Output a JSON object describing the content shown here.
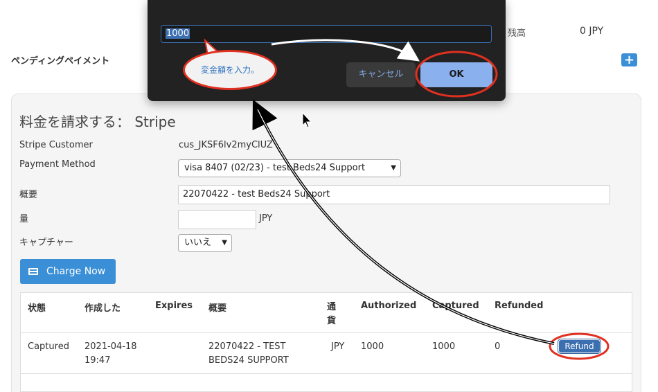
{
  "header": {
    "balance_label": "残高",
    "balance_value": "0 JPY",
    "pending_title": "ペンディングペイメント",
    "add_label": "+"
  },
  "dialog": {
    "input_value": "1000",
    "hint": "変金額を入力。",
    "cancel_label": "キャンセル",
    "ok_label": "OK"
  },
  "charge": {
    "title": "料金を請求する： Stripe",
    "customer_label": "Stripe Customer",
    "customer_value": "cus_JKSF6lv2myClUZ",
    "method_label": "Payment Method",
    "method_value": "visa 8407 (02/23) - test Beds24 Support",
    "summary_label": "概要",
    "summary_value": "22070422 - test Beds24 Support",
    "amount_label": "量",
    "amount_value": "",
    "amount_unit": "JPY",
    "capture_label": "キャプチャー",
    "capture_value": "いいえ",
    "charge_button": "Charge Now"
  },
  "table": {
    "headers": {
      "status": "状態",
      "created": "作成した",
      "expires": "Expires",
      "summary": "概要",
      "currency": "通貨",
      "authorized": "Authorized",
      "captured": "Captured",
      "refunded": "Refunded"
    },
    "rows": [
      {
        "status": "Captured",
        "created_date": "2021-04-18",
        "created_time": "19:47",
        "expires": "",
        "summary_1": "22070422 - TEST",
        "summary_2": "BEDS24 SUPPORT",
        "currency": "JPY",
        "authorized": "1000",
        "captured": "1000",
        "refunded": "0",
        "action": "Refund"
      }
    ]
  },
  "colors": {
    "accent": "#3a8fd6",
    "annotation": "#e03020",
    "dialog_bg": "#222222",
    "ok_bg": "#8bb0ee"
  }
}
